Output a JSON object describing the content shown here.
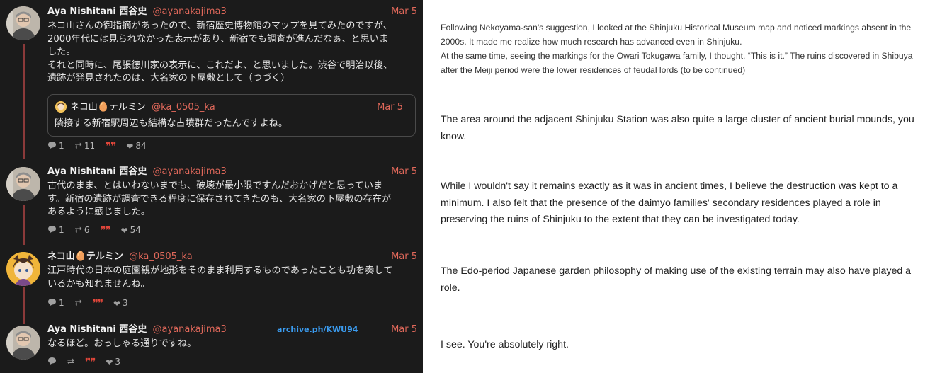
{
  "thread": {
    "tweets": [
      {
        "name": "Aya Nishitani 西谷史",
        "handle": "@ayanakajima3",
        "date": "Mar 5",
        "text": "ネコ山さんの御指摘があったので、新宿歴史博物館のマップを見てみたのですが、\n2000年代には見られなかった表示があり、新宿でも調査が進んだなぁ、と思いま\nした。\nそれと同時に、尾張徳川家の表示に、これだよ、と思いました。渋谷で明治以後、\n遺跡が発見されたのは、大名家の下屋敷として（つづく）",
        "quote": {
          "name": "ネコ山🥚テルミン",
          "handle": "@ka_0505_ka",
          "date": "Mar 5",
          "text": "隣接する新宿駅周辺も結構な古墳群だったんですよね。"
        },
        "replies": "1",
        "retweets": "11",
        "likes": "84"
      },
      {
        "name": "Aya Nishitani 西谷史",
        "handle": "@ayanakajima3",
        "date": "Mar 5",
        "text": "古代のまま、とはいわないまでも、破壊が最小限ですんだおかげだと思っていま\nす。新宿の遺跡が調査できる程度に保存されてきたのも、大名家の下屋敷の存在が\nあるように感じました。",
        "replies": "1",
        "retweets": "6",
        "likes": "54"
      },
      {
        "name": "ネコ山🥚テルミン",
        "handle": "@ka_0505_ka",
        "date": "Mar 5",
        "text": "江戸時代の日本の庭園観が地形をそのまま利用するものであったことも功を奏して\nいるかも知れませんね。",
        "replies": "1",
        "likes": "3"
      },
      {
        "name": "Aya Nishitani 西谷史",
        "handle": "@ayanakajima3",
        "date": "Mar 5",
        "archive": "archive.ph/KWU94",
        "text": "なるほど。おっしゃる通りですね。",
        "likes": "3"
      }
    ]
  },
  "translations": {
    "t1": "Following Nekoyama-san's suggestion, I looked at the Shinjuku Historical Museum map and noticed markings absent in the 2000s. It made me realize how much research has advanced even in Shinjuku.\nAt the same time, seeing the markings for the Owari Tokugawa family, I thought, “This is it.” The ruins discovered in Shibuya after the Meiji period were the lower residences of feudal lords (to be continued)",
    "t2": "The area around the adjacent Shinjuku Station was also quite a large cluster of ancient burial mounds, you know.",
    "t3": "While I wouldn't say it remains exactly as it was in ancient times, I believe the destruction was kept to a minimum. I also felt that the presence of the daimyo families' secondary residences played a role in preserving the ruins of Shinjuku to the extent that they can be investigated today.",
    "t4": "The Edo-period Japanese garden philosophy of making use of the existing terrain may also have played a role.",
    "t5": "I see. You're absolutely right."
  },
  "icons": {
    "reply": "speech-bubble-icon",
    "retweet": "retweet-icon",
    "quote": "quote-icon",
    "like": "heart-icon"
  },
  "colors": {
    "left_bg": "#1b1b1b",
    "accent": "#e0685a",
    "thread_line": "#8b3a3a",
    "quote_icon": "#e0463a",
    "archive_link": "#3b9cf0"
  }
}
